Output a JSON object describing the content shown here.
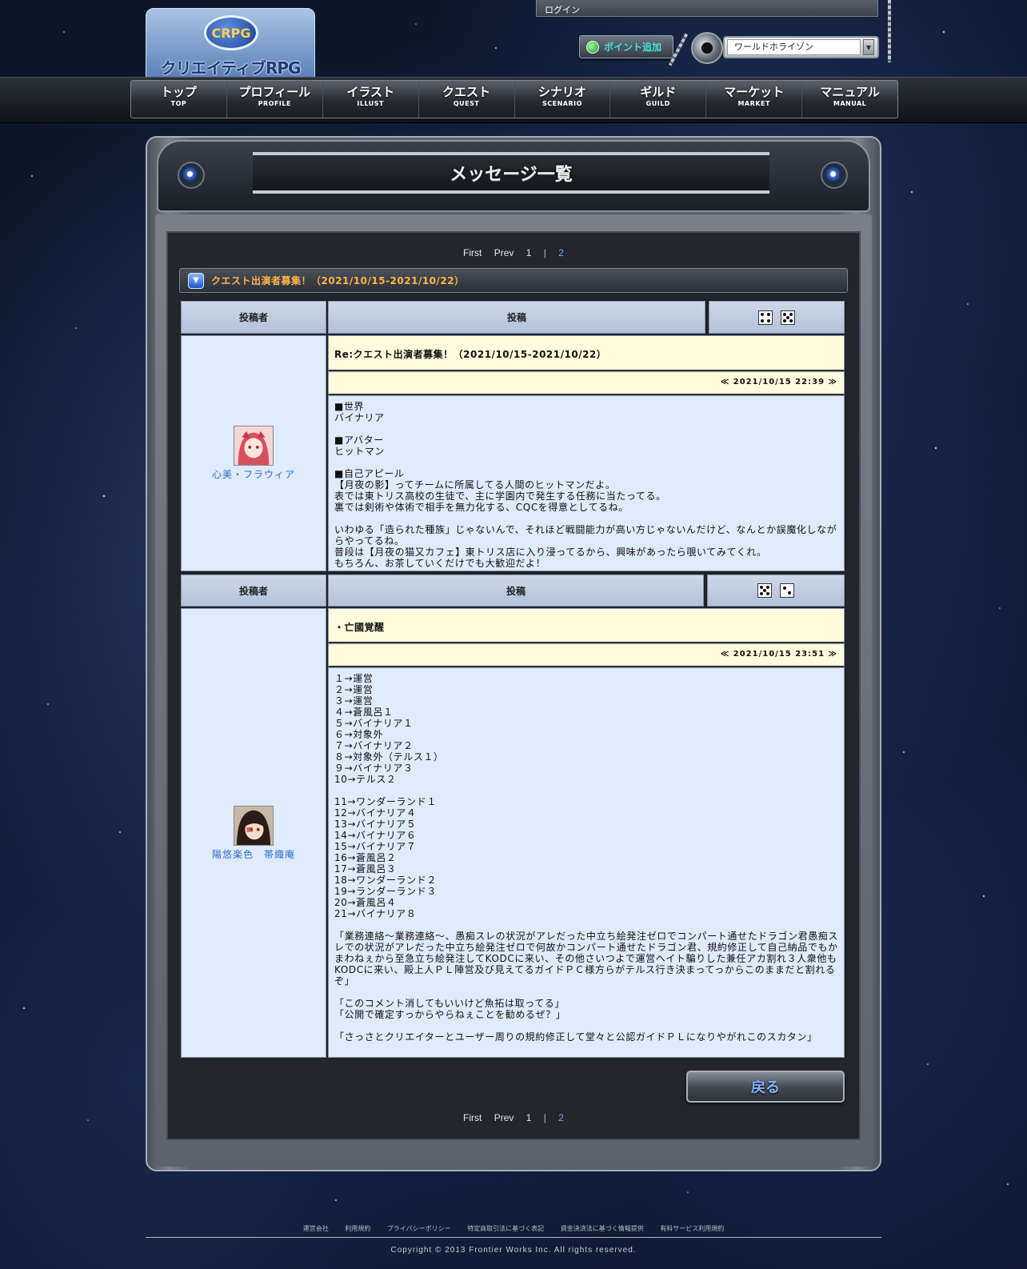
{
  "header": {
    "logo_badge": "CRPG",
    "logo_text": "クリエイティブRPG",
    "login_label": "ログイン",
    "point_button": "ポイント追加",
    "world_select_value": "ワールドホライゾン"
  },
  "nav": [
    {
      "jp": "トップ",
      "en": "TOP"
    },
    {
      "jp": "プロフィール",
      "en": "PROFILE"
    },
    {
      "jp": "イラスト",
      "en": "ILLUST"
    },
    {
      "jp": "クエスト",
      "en": "QUEST"
    },
    {
      "jp": "シナリオ",
      "en": "SCENARIO"
    },
    {
      "jp": "ギルド",
      "en": "GUILD"
    },
    {
      "jp": "マーケット",
      "en": "MARKET"
    },
    {
      "jp": "マニュアル",
      "en": "MANUAL"
    }
  ],
  "page_title": "メッセージ一覧",
  "pager": {
    "first": "First",
    "prev": "Prev",
    "page1": "1",
    "sep": "|",
    "page2": "2"
  },
  "thread_title": "クエスト出演者募集！（2021/10/15-2021/10/22）",
  "table_headers": {
    "author": "投稿者",
    "post": "投稿"
  },
  "posts": [
    {
      "author": "心美・フラウィア",
      "subject": "Re:クエスト出演者募集！（2021/10/15-2021/10/22）",
      "date": "≪ 2021/10/15 22:39 ≫",
      "dice": [
        4,
        5
      ],
      "body": "■世界\nバイナリア\n\n■アバター\nヒットマン\n\n■自己アピール\n【月夜の影】ってチームに所属してる人間のヒットマンだよ。\n表では東トリス高校の生徒で、主に学園内で発生する任務に当たってる。\n裏では剣術や体術で相手を無力化する、CQCを得意としてるね。\n\nいわゆる「造られた種族」じゃないんで、それほど戦闘能力が高い方じゃないんだけど、なんとか誤魔化しながらやってるね。\n普段は【月夜の猫又カフェ】東トリス店に入り浸ってるから、興味があったら覗いてみてくれ。\nもちろん、お茶していくだけでも大歓迎だよ！"
    },
    {
      "author": "陽悠楽色　帯織庵",
      "subject": "・亡國覚醒",
      "date": "≪ 2021/10/15 23:51 ≫",
      "dice": [
        5,
        2
      ],
      "body": "１→運営\n２→運営\n３→運営\n４→蒼風呂１\n５→バイナリア１\n６→対象外\n７→バイナリア２\n８→対象外（テルス１）\n９→バイナリア３\n10→テルス２\n\n11→ワンダーランド１\n12→バイナリア４\n13→バイナリア５\n14→バイナリア６\n15→バイナリア７\n16→蒼風呂２\n17→蒼風呂３\n18→ワンダーランド２\n19→ランダーランド３\n20→蒼風呂４\n21→バイナリア８\n\n「業務連絡〜業務連絡〜、愚痴スレの状況がアレだった中立ち絵発注ゼロでコンパート通せたドラゴン君愚痴スレでの状況がアレだった中立ち絵発注ゼロで何故かコンパート通せたドラゴン君、規約修正して自己納品でもかまわねぇから至急立ち絵発注してKODCに来い、その他さいつよで運営ヘイト騙りした兼任アカ割れ３人衆他もKODCに来い、殿上人ＰＬ陣営及び見えてるガイドＰＣ様方らがテルス行き決まってっからこのままだと割れるぞ」\n\n「このコメント消してもいいけど魚拓は取ってる」\n「公開で確定すっからやらねぇことを勧めるぜ？」\n\n「さっさとクリエイターとユーザー周りの規約修正して堂々と公認ガイドＰＬになりやがれこのスカタン」"
    }
  ],
  "back_button": "戻る",
  "footer": {
    "links": [
      "運営会社",
      "利用規約",
      "プライバシーポリシー",
      "特定商取引法に基づく表記",
      "資金決済法に基づく情報提供",
      "有料サービス利用規約"
    ],
    "copyright": "Copyright © 2013 Frontier Works Inc. All rights reserved."
  }
}
